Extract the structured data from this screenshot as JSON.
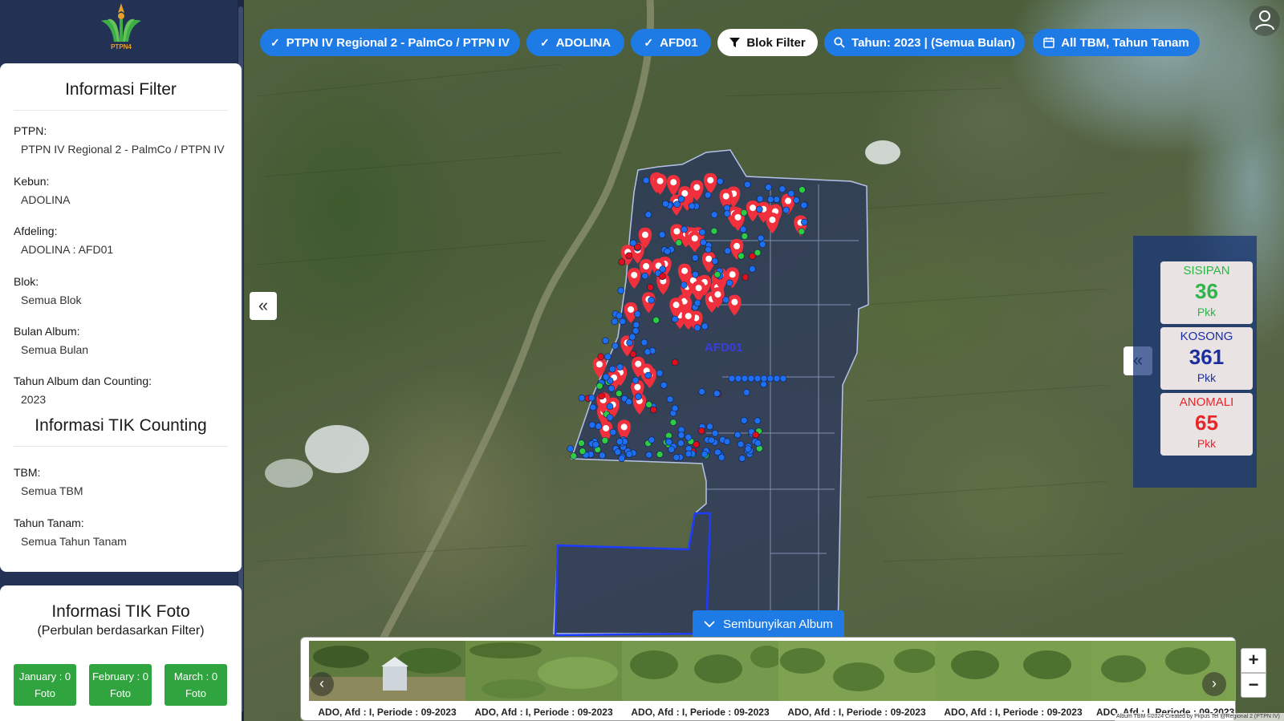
{
  "logo": {
    "text": "PTPN4"
  },
  "top_filters": [
    {
      "label": "PTPN IV Regional 2 - PalmCo / PTPN IV",
      "icon": "check-icon"
    },
    {
      "label": "ADOLINA",
      "icon": "check-icon"
    },
    {
      "label": "AFD01",
      "icon": "check-icon"
    },
    {
      "label": "Blok Filter",
      "icon": "filter-icon"
    },
    {
      "label": "Tahun: 2023 | (Semua Bulan)",
      "icon": "search-icon"
    },
    {
      "label": "All TBM, Tahun Tanam",
      "icon": "calendar-icon"
    }
  ],
  "filter_info": {
    "title": "Informasi Filter",
    "ptpn_label": "PTPN:",
    "ptpn_value": "PTPN IV Regional 2 - PalmCo / PTPN IV",
    "kebun_label": "Kebun:",
    "kebun_value": "ADOLINA",
    "afdeling_label": "Afdeling:",
    "afdeling_value": "ADOLINA : AFD01",
    "blok_label": "Blok:",
    "blok_value": "Semua Blok",
    "bulan_label": "Bulan Album:",
    "bulan_value": "Semua Bulan",
    "tahun_label": "Tahun Album dan Counting:",
    "tahun_value": "2023"
  },
  "tik_counting": {
    "title": "Informasi TIK Counting",
    "tbm_label": "TBM:",
    "tbm_value": "Semua TBM",
    "tanam_label": "Tahun Tanam:",
    "tanam_value": "Semua Tahun Tanam"
  },
  "tik_foto": {
    "title": "Informasi TIK Foto",
    "subtitle": "(Perbulan berdasarkan Filter)",
    "months": [
      {
        "line1": "January : 0",
        "line2": "Foto"
      },
      {
        "line1": "February : 0",
        "line2": "Foto"
      },
      {
        "line1": "March : 0",
        "line2": "Foto"
      }
    ]
  },
  "map": {
    "area_label": "AFD01"
  },
  "stats": [
    {
      "title": "SISIPAN",
      "value": "36",
      "unit": "Pkk",
      "color": "#2fb44a"
    },
    {
      "title": "KOSONG",
      "value": "361",
      "unit": "Pkk",
      "color": "#1c2f9e"
    },
    {
      "title": "ANOMALI",
      "value": "65",
      "unit": "Pkk",
      "color": "#e8262b"
    }
  ],
  "album": {
    "toggle_label": "Sembunyikan Album",
    "captions": [
      "ADO, Afd : I, Periode : 09-2023",
      "ADO, Afd : I, Periode : 09-2023",
      "ADO, Afd : I, Periode : 09-2023",
      "ADO, Afd : I, Periode : 09-2023",
      "ADO, Afd : I, Periode : 09-2023",
      "ADO, Afd : I, Periode : 09-2023"
    ]
  },
  "zoom": {
    "in": "+",
    "out": "−"
  },
  "attribution": "Album TBM ©2024 Created by Pkpus Tel @Regional 2 (PTPN IV)",
  "colors": {
    "accent": "#1e7be6",
    "sidebar": "#233254",
    "marker_red": "#f0303c",
    "month_green": "#2fa43f"
  }
}
